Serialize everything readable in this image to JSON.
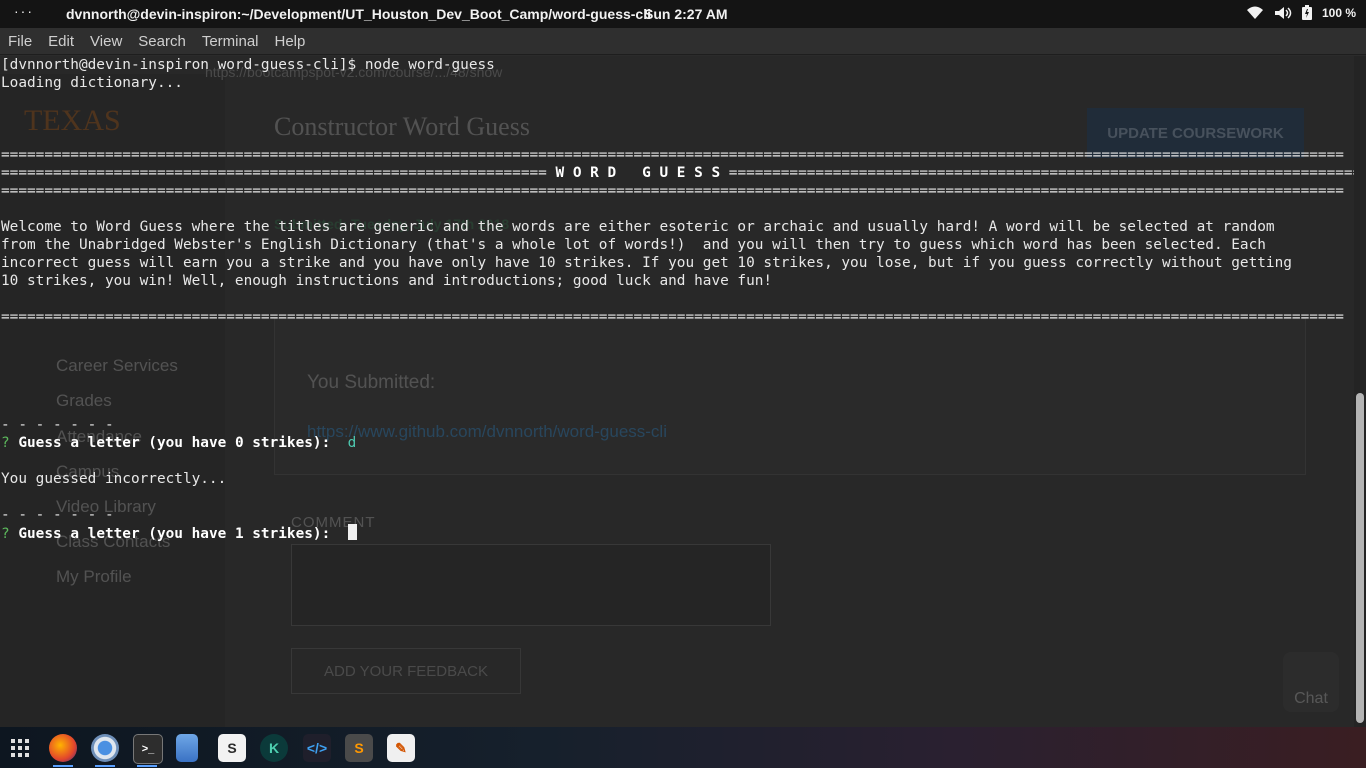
{
  "topbar": {
    "dots": "···",
    "window_title": "dvnnorth@devin-inspiron:~/Development/UT_Houston_Dev_Boot_Camp/word-guess-cli",
    "clock": "Sun  2:27 AM",
    "battery": "100 %"
  },
  "menubar": {
    "items": [
      "File",
      "Edit",
      "View",
      "Search",
      "Terminal",
      "Help"
    ]
  },
  "background_browser": {
    "url": "https://bootcampspot-v2.com/course/.../48/show",
    "heading": "Constructor Word Guess",
    "update_button": "UPDATE COURSEWORK",
    "submitted_date": "Submitted: Tuesday, July 17th 2018",
    "you_submitted": "You Submitted:",
    "submission_link": "https://www.github.com/dvnnorth/word-guess-cli",
    "nav": [
      "Career Services",
      "Grades",
      "Attendance",
      "Campus",
      "Video Library",
      "Class Contacts",
      "My Profile"
    ],
    "comment_label": "COMMENT",
    "add_feedback_button": "ADD YOUR FEEDBACK",
    "chat_label": "Chat",
    "logo": "TEXAS"
  },
  "terminal": {
    "prompt_line": "[dvnnorth@devin-inspiron word-guess-cli]$ node word-guess",
    "loading": "Loading dictionary...",
    "rule": "===========================================================================================================================================================",
    "banner_left": "===============================================================",
    "banner_title": " W O R D   G U E S S ",
    "banner_right": "===========================================================================================================================================================",
    "welcome_lines": [
      "Welcome to Word Guess where the titles are generic and the words are either esoteric or archaic and usually hard! A word will be selected at random",
      "from the Unabridged Webster's English Dictionary (that's a whole lot of words!)  and you will then try to guess which word has been selected. Each",
      "incorrect guess will earn you a strike and you have only have 10 strikes. If you get 10 strikes, you lose, but if you guess correctly without getting",
      "10 strikes, you win! Well, enough instructions and introductions; good luck and have fun!"
    ],
    "blanks": "- - - - - - -",
    "q_mark": "?",
    "guess_prompt_1": "Guess a letter (you have 0 strikes):",
    "guess_answer_1": "d",
    "incorrect": "You guessed incorrectly...",
    "guess_prompt_2": "Guess a letter (you have 1 strikes):"
  },
  "dock": {
    "apps": [
      "app-grid",
      "firefox",
      "chromium",
      "terminal",
      "files",
      "slack",
      "gitkraken",
      "vscode",
      "sublime-text",
      "text-editor"
    ]
  }
}
